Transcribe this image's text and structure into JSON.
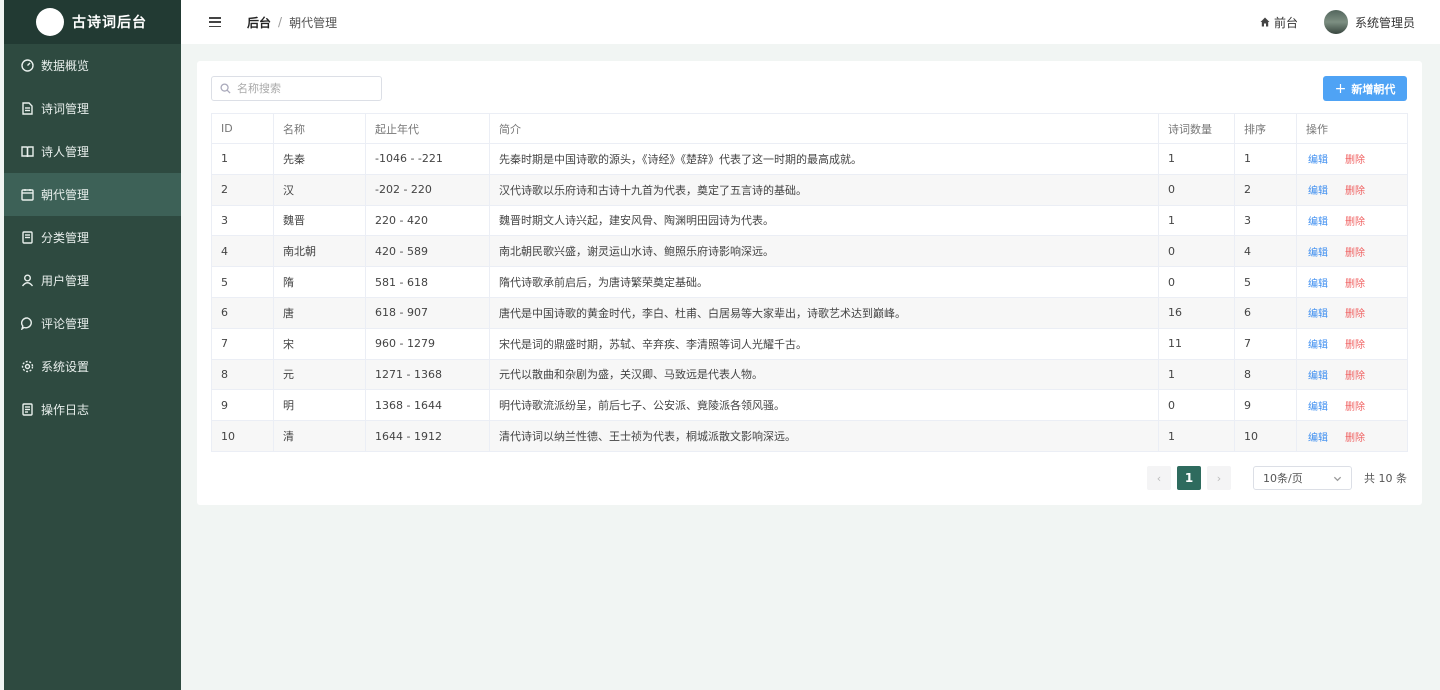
{
  "sidebar": {
    "logo_text": "古诗词后台",
    "items": [
      {
        "label": "数据概览",
        "icon": "dashboard-icon"
      },
      {
        "label": "诗词管理",
        "icon": "document-icon"
      },
      {
        "label": "诗人管理",
        "icon": "book-icon"
      },
      {
        "label": "朝代管理",
        "icon": "calendar-icon"
      },
      {
        "label": "分类管理",
        "icon": "folder-icon"
      },
      {
        "label": "用户管理",
        "icon": "user-icon"
      },
      {
        "label": "评论管理",
        "icon": "comment-icon"
      },
      {
        "label": "系统设置",
        "icon": "gear-icon"
      },
      {
        "label": "操作日志",
        "icon": "log-icon"
      }
    ],
    "active_index": 3
  },
  "header": {
    "breadcrumb_root": "后台",
    "breadcrumb_separator": "/",
    "breadcrumb_current": "朝代管理",
    "front_label": "前台",
    "user_name": "系统管理员"
  },
  "toolbar": {
    "search_placeholder": "名称搜索",
    "add_label": "新增朝代",
    "add_color": "#4fa3f5"
  },
  "table": {
    "columns": [
      "ID",
      "名称",
      "起止年代",
      "简介",
      "诗词数量",
      "排序",
      "操作"
    ],
    "rows": [
      {
        "id": "1",
        "name": "先秦",
        "years": "-1046 - -221",
        "desc": "先秦时期是中国诗歌的源头，《诗经》《楚辞》代表了这一时期的最高成就。",
        "count": "1",
        "order": "1"
      },
      {
        "id": "2",
        "name": "汉",
        "years": "-202 - 220",
        "desc": "汉代诗歌以乐府诗和古诗十九首为代表，奠定了五言诗的基础。",
        "count": "0",
        "order": "2"
      },
      {
        "id": "3",
        "name": "魏晋",
        "years": "220 - 420",
        "desc": "魏晋时期文人诗兴起，建安风骨、陶渊明田园诗为代表。",
        "count": "1",
        "order": "3"
      },
      {
        "id": "4",
        "name": "南北朝",
        "years": "420 - 589",
        "desc": "南北朝民歌兴盛，谢灵运山水诗、鲍照乐府诗影响深远。",
        "count": "0",
        "order": "4"
      },
      {
        "id": "5",
        "name": "隋",
        "years": "581 - 618",
        "desc": "隋代诗歌承前启后，为唐诗繁荣奠定基础。",
        "count": "0",
        "order": "5"
      },
      {
        "id": "6",
        "name": "唐",
        "years": "618 - 907",
        "desc": "唐代是中国诗歌的黄金时代，李白、杜甫、白居易等大家辈出，诗歌艺术达到巅峰。",
        "count": "16",
        "order": "6"
      },
      {
        "id": "7",
        "name": "宋",
        "years": "960 - 1279",
        "desc": "宋代是词的鼎盛时期，苏轼、辛弃疾、李清照等词人光耀千古。",
        "count": "11",
        "order": "7"
      },
      {
        "id": "8",
        "name": "元",
        "years": "1271 - 1368",
        "desc": "元代以散曲和杂剧为盛，关汉卿、马致远是代表人物。",
        "count": "1",
        "order": "8"
      },
      {
        "id": "9",
        "name": "明",
        "years": "1368 - 1644",
        "desc": "明代诗歌流派纷呈，前后七子、公安派、竟陵派各领风骚。",
        "count": "0",
        "order": "9"
      },
      {
        "id": "10",
        "name": "清",
        "years": "1644 - 1912",
        "desc": "清代诗词以纳兰性德、王士祯为代表，桐城派散文影响深远。",
        "count": "1",
        "order": "10"
      }
    ],
    "edit_label": "编辑",
    "delete_label": "删除"
  },
  "pagination": {
    "prev": "‹",
    "next": "›",
    "current_page": "1",
    "page_size": "10条/页",
    "total": "共 10 条"
  },
  "colors": {
    "sidebar_bg": "#2e4a40",
    "sidebar_active": "#3d6157",
    "accent": "#2e6b5e",
    "edit": "#3d8ef0",
    "delete": "#f06060"
  }
}
